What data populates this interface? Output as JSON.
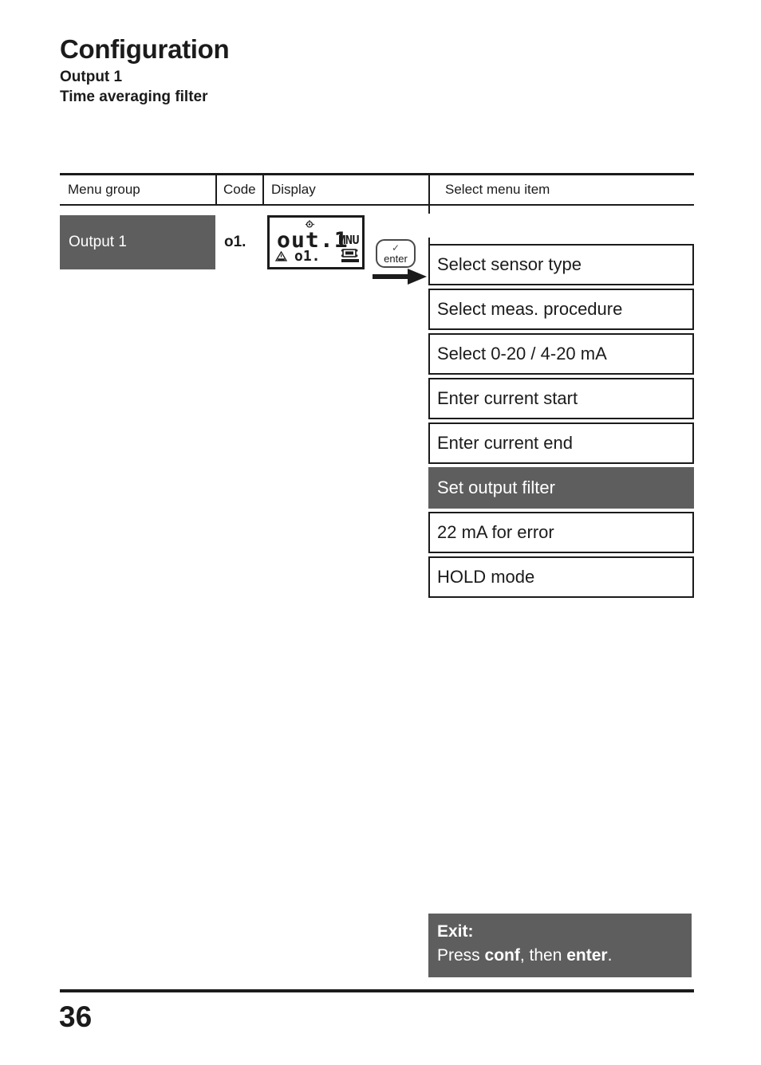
{
  "document": {
    "title": "Configuration",
    "subtitle_1": "Output 1",
    "subtitle_2": "Time averaging filter",
    "page_number": "36"
  },
  "table": {
    "headers": {
      "menu_group": "Menu group",
      "code": "Code",
      "display": "Display",
      "select_menu_item": "Select menu item"
    },
    "row": {
      "menu_group": "Output 1",
      "code": "o1."
    }
  },
  "lcd": {
    "main_value": "out.1",
    "mode_tag": "MNU",
    "sub_value": "o1.",
    "icons": {
      "top": "sun-icon",
      "hold": "hold-warning-triangle-icon",
      "meas": "meas-manual-icon"
    }
  },
  "enter_key": {
    "label": "enter",
    "check_glyph": "✓"
  },
  "menu_items": [
    {
      "label": "Select sensor type",
      "selected": false
    },
    {
      "label": "Select meas. procedure",
      "selected": false
    },
    {
      "label": "Select 0-20 / 4-20 mA",
      "selected": false
    },
    {
      "label": "Enter current start",
      "selected": false
    },
    {
      "label": "Enter current end",
      "selected": false
    },
    {
      "label": "Set output filter",
      "selected": true
    },
    {
      "label": "22 mA for error",
      "selected": false
    },
    {
      "label": "HOLD mode",
      "selected": false
    }
  ],
  "exit_box": {
    "title": "Exit:",
    "instruction_prefix": "Press ",
    "instruction_key_1": "conf",
    "instruction_middle": ", then ",
    "instruction_key_2": "enter",
    "instruction_suffix": "."
  },
  "colors": {
    "gray_fill": "#5e5e5e",
    "ink": "#1b1b1b"
  }
}
